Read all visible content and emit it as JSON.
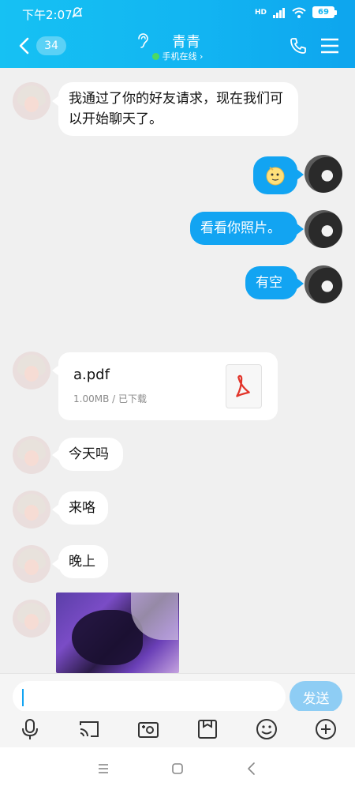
{
  "status_bar": {
    "time": "下午2:07",
    "network_label": "HD",
    "battery": "69"
  },
  "header": {
    "back_badge": "34",
    "title": "青青",
    "subtitle": "手机在线",
    "subtitle_chevron": "›"
  },
  "messages": [
    {
      "side": "in",
      "text": "我通过了你的好友请求，现在我们可以开始聊天了。"
    },
    {
      "side": "out",
      "type": "emoji",
      "icon": "emoji-icon"
    },
    {
      "side": "out",
      "text": "看看你照片。"
    },
    {
      "side": "out",
      "text": "有空"
    },
    {
      "side": "in",
      "type": "file",
      "file_name": "a.pdf",
      "file_size": "1.00MB",
      "file_status": "已下载"
    },
    {
      "side": "in",
      "text": "今天吗"
    },
    {
      "side": "in",
      "text": "来咯"
    },
    {
      "side": "in",
      "text": "晚上"
    },
    {
      "side": "in",
      "type": "image"
    }
  ],
  "input": {
    "value": "",
    "send_label": "发送"
  },
  "toolbar": {
    "items": [
      "microphone-icon",
      "cast-icon",
      "camera-icon",
      "photo-album-icon",
      "smiley-icon",
      "plus-icon"
    ]
  },
  "colors": {
    "header_gradient_start": "#16c1f3",
    "header_gradient_end": "#0ea5ee",
    "outgoing_bubble": "#12a4f2",
    "send_button": "#8ecdf4",
    "online_dot": "#4cd964"
  }
}
